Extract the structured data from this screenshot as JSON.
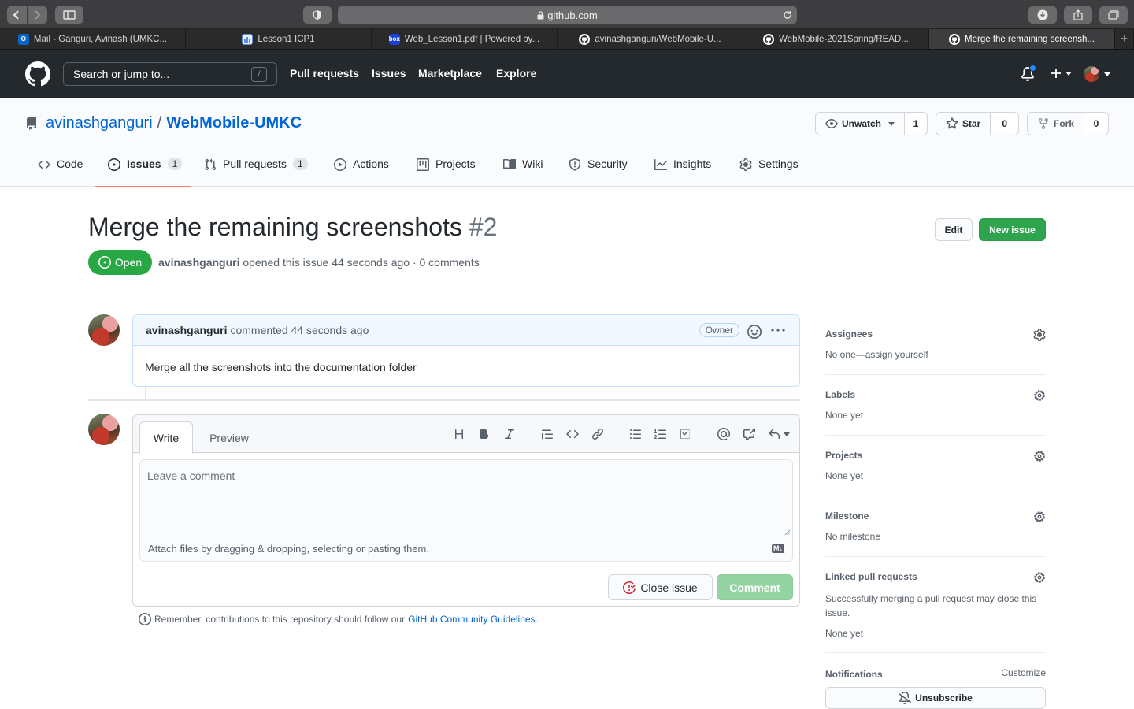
{
  "browser": {
    "url": "github.com",
    "tabs": [
      {
        "title": "Mail - Ganguri, Avinash (UMKC...",
        "icon": "outlook-icon",
        "color": "#0a64c8"
      },
      {
        "title": "Lesson1 ICP1",
        "icon": "chart-icon",
        "color": "#5b8dd9"
      },
      {
        "title": "Web_Lesson1.pdf | Powered by...",
        "icon": "box-icon",
        "color": "#1a3fd6"
      },
      {
        "title": "avinashganguri/WebMobile-U...",
        "icon": "github-icon",
        "color": "#ffffff"
      },
      {
        "title": "WebMobile-2021Spring/READ...",
        "icon": "github-icon",
        "color": "#ffffff"
      },
      {
        "title": "Merge the remaining screensh...",
        "icon": "github-icon",
        "color": "#ffffff"
      }
    ]
  },
  "header": {
    "search_placeholder": "Search or jump to...",
    "slash": "/",
    "nav": [
      "Pull requests",
      "Issues",
      "Marketplace",
      "Explore"
    ]
  },
  "repo": {
    "owner": "avinashganguri",
    "separator": "/",
    "name": "WebMobile-UMKC",
    "watch_label": "Unwatch",
    "watch_count": "1",
    "star_label": "Star",
    "star_count": "0",
    "fork_label": "Fork",
    "fork_count": "0",
    "tabs": [
      {
        "label": "Code"
      },
      {
        "label": "Issues",
        "count": "1"
      },
      {
        "label": "Pull requests",
        "count": "1"
      },
      {
        "label": "Actions"
      },
      {
        "label": "Projects"
      },
      {
        "label": "Wiki"
      },
      {
        "label": "Security"
      },
      {
        "label": "Insights"
      },
      {
        "label": "Settings"
      }
    ]
  },
  "issue": {
    "title": "Merge the remaining screenshots",
    "number": "#2",
    "state": "Open",
    "author": "avinashganguri",
    "meta": "opened this issue 44 seconds ago · 0 comments",
    "edit_label": "Edit",
    "new_issue_label": "New issue",
    "comment": {
      "author": "avinashganguri",
      "time": "commented 44 seconds ago",
      "badge": "Owner",
      "body": "Merge all the screenshots into the documentation folder"
    }
  },
  "editor": {
    "write_tab": "Write",
    "preview_tab": "Preview",
    "placeholder": "Leave a comment",
    "attach_text": "Attach files by dragging & dropping, selecting or pasting them.",
    "md_label": "M↓",
    "close_label": "Close issue",
    "comment_label": "Comment",
    "guidelines_prefix": "Remember, contributions to this repository should follow our",
    "guidelines_link": "GitHub Community Guidelines",
    "guidelines_suffix": "."
  },
  "sidebar": {
    "assignees": {
      "label": "Assignees",
      "value": "No one—assign yourself"
    },
    "labels": {
      "label": "Labels",
      "value": "None yet"
    },
    "projects": {
      "label": "Projects",
      "value": "None yet"
    },
    "milestone": {
      "label": "Milestone",
      "value": "No milestone"
    },
    "linked": {
      "label": "Linked pull requests",
      "desc": "Successfully merging a pull request may close this issue.",
      "value": "None yet"
    },
    "notifications": {
      "label": "Notifications",
      "customize": "Customize",
      "unsubscribe": "Unsubscribe"
    }
  },
  "colors": {
    "green": "#2ea44f",
    "link": "#0366d6",
    "header": "#24292e"
  }
}
